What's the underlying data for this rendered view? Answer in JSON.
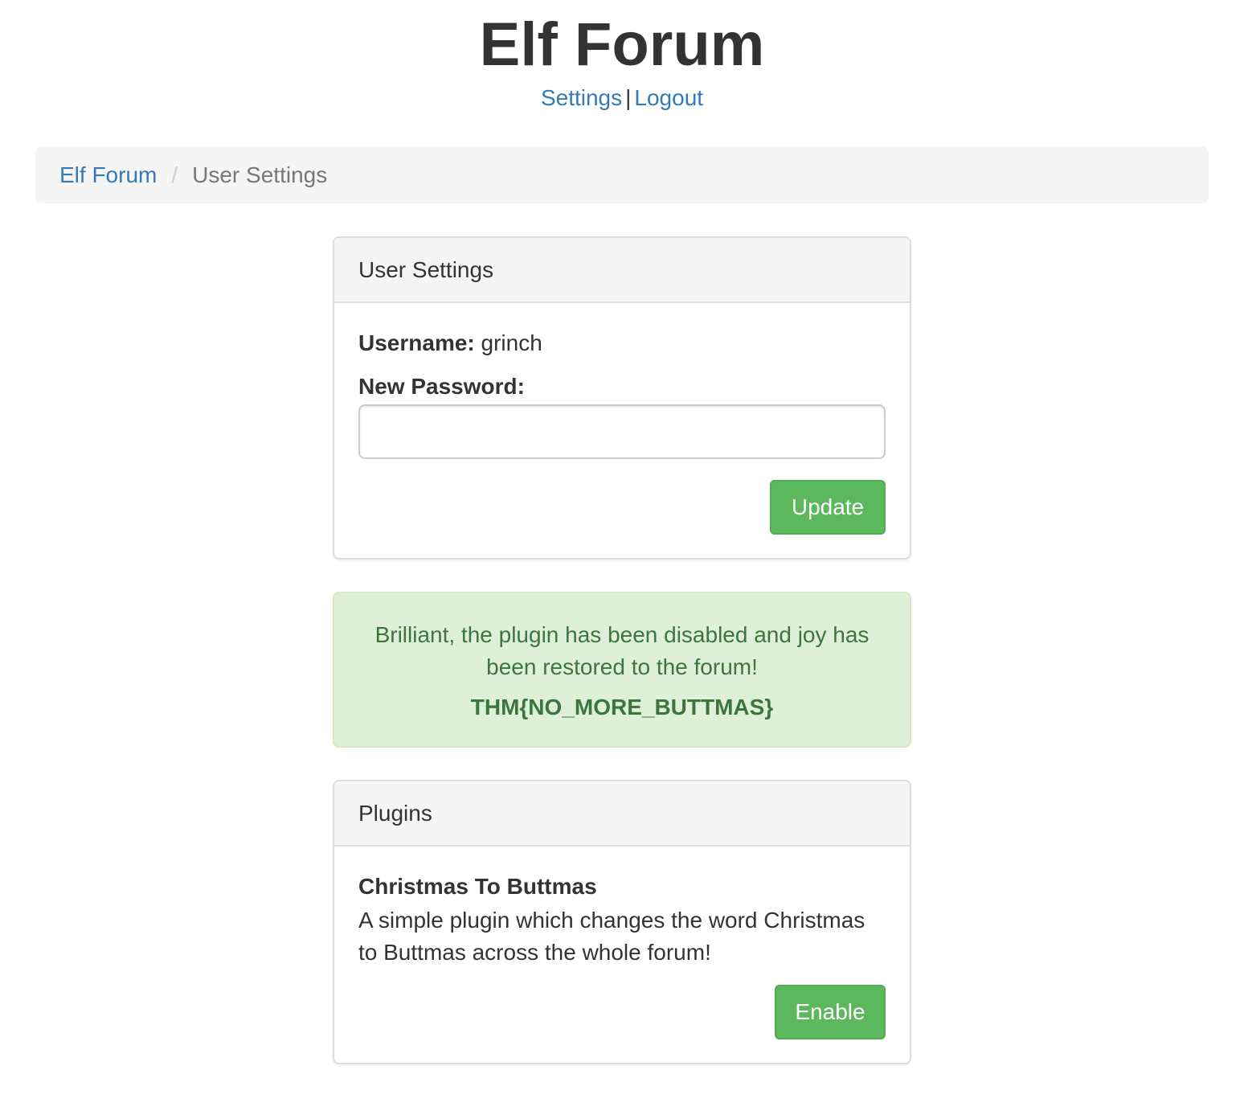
{
  "header": {
    "title": "Elf Forum",
    "settings_link": "Settings",
    "separator": "|",
    "logout_link": "Logout"
  },
  "breadcrumb": {
    "home": "Elf Forum",
    "divider": "/",
    "current": "User Settings"
  },
  "user_settings": {
    "heading": "User Settings",
    "username_label": "Username:",
    "username_value": "grinch",
    "password_label": "New Password:",
    "password_value": "",
    "update_button": "Update"
  },
  "alert": {
    "message": "Brilliant, the plugin has been disabled and joy has been restored to the forum!",
    "flag": "THM{NO_MORE_BUTTMAS}"
  },
  "plugins": {
    "heading": "Plugins",
    "items": [
      {
        "name": "Christmas To Buttmas",
        "description": "A simple plugin which changes the word Christmas to Buttmas across the whole forum!",
        "button": "Enable"
      }
    ]
  },
  "colors": {
    "link": "#337ab7",
    "success_button": "#5cb85c",
    "alert_background": "#dff0d8",
    "alert_text": "#3c763d",
    "panel_heading": "#f5f5f5"
  }
}
